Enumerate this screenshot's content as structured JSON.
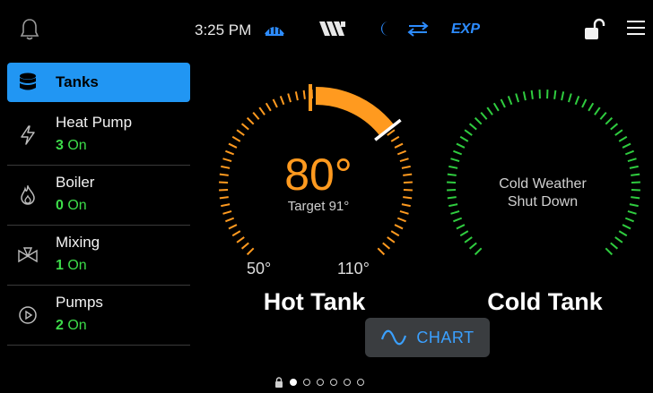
{
  "topbar": {
    "time": "3:25 PM",
    "mode": "EXP",
    "icons": [
      "bell-icon",
      "heating-icon",
      "wiring-icon",
      "moon-icon",
      "swap-arrows-icon",
      "unlocked-padlock-icon",
      "menu-icon"
    ]
  },
  "sidebar": {
    "items": [
      {
        "label": "Tanks",
        "icon": "database-icon"
      },
      {
        "label": "Heat Pump",
        "count": "3",
        "state": "On",
        "icon": "lightning-icon"
      },
      {
        "label": "Boiler",
        "count": "0",
        "state": "On",
        "icon": "flame-icon"
      },
      {
        "label": "Mixing",
        "count": "1",
        "state": "On",
        "icon": "mixing-valve-icon"
      },
      {
        "label": "Pumps",
        "count": "2",
        "state": "On",
        "icon": "play-circle-icon"
      }
    ]
  },
  "hot_tank": {
    "title": "Hot Tank",
    "temp": "80°",
    "target": "Target 91°",
    "min": "50°",
    "max": "110°",
    "color": "#ff9a1f"
  },
  "cold_tank": {
    "title": "Cold Tank",
    "status_line1": "Cold Weather",
    "status_line2": "Shut Down",
    "color": "#2fcc3f"
  },
  "chart_button": {
    "label": "CHART"
  },
  "pager": {
    "pages": 6,
    "active": 1
  },
  "colors": {
    "accent": "#2196f3",
    "on_green": "#3ddc4a",
    "link_blue": "#3aa0ff"
  }
}
